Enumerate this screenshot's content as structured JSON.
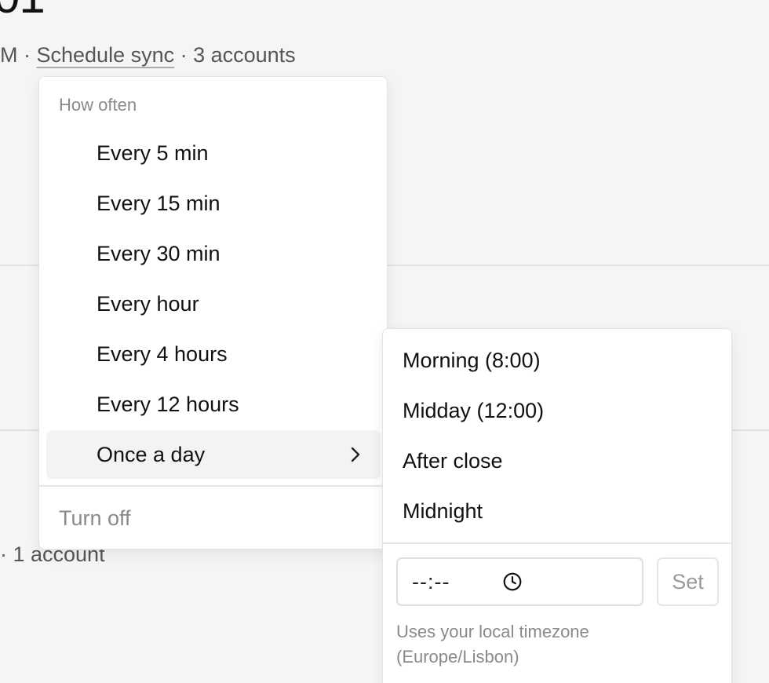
{
  "background": {
    "heading_fragment": "01",
    "meta_prefix": "M · ",
    "meta_link": "Schedule sync",
    "meta_suffix": " · 3 accounts",
    "second_meta": "· 1 account"
  },
  "menu": {
    "label": "How often",
    "items": [
      {
        "label": "Every 5 min"
      },
      {
        "label": "Every 15 min"
      },
      {
        "label": "Every 30 min"
      },
      {
        "label": "Every hour"
      },
      {
        "label": "Every 4 hours"
      },
      {
        "label": "Every 12 hours"
      },
      {
        "label": "Once a day",
        "has_submenu": true,
        "active": true
      }
    ],
    "turn_off_label": "Turn off"
  },
  "submenu": {
    "items": [
      {
        "label": "Morning (8:00)"
      },
      {
        "label": "Midday (12:00)"
      },
      {
        "label": "After close"
      },
      {
        "label": "Midnight"
      }
    ],
    "time_input": {
      "placeholder": "--:--",
      "icon": "clock-icon"
    },
    "set_label": "Set",
    "timezone_note": "Uses your local timezone (Europe/Lisbon)"
  },
  "colors": {
    "page_background": "#f5f5f5",
    "menu_background": "#ffffff",
    "active_item_background": "#f3f3f3",
    "muted_text": "#8a8a8a",
    "primary_text": "#111111",
    "border": "#e3e3e3"
  }
}
